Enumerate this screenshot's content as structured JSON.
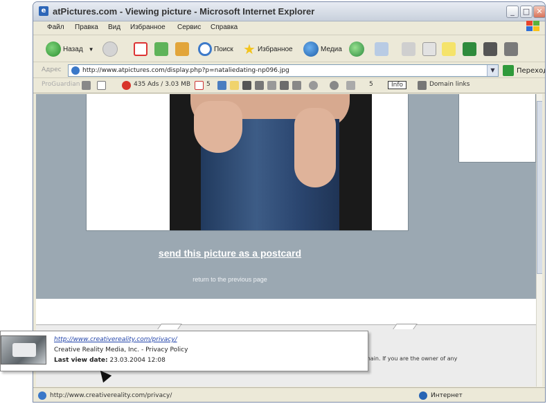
{
  "window": {
    "title": "atPictures.com - Viewing picture - Microsoft Internet Explorer",
    "minimize": "_",
    "maximize": "□",
    "close": "✕"
  },
  "menu": [
    "Файл",
    "Правка",
    "Вид",
    "Избранное",
    "Сервис",
    "Справка"
  ],
  "toolbar": {
    "back_label": "Назад",
    "search_label": "Поиск",
    "favorites_label": "Избранное",
    "media_label": "Медиа"
  },
  "address": {
    "label": "Адрес",
    "url": "http://www.atpictures.com/display.php?p=nataliedating-np096.jpg",
    "go_label": "Переход"
  },
  "links_bar": {
    "label": "ProGuardian",
    "counter": "435 Ads / 3.03 MB",
    "count5": "5",
    "count5b": "5",
    "info_label": "Info",
    "domain_label": "Domain links"
  },
  "content": {
    "postcard_link": "send this picture as a postcard",
    "return_link": "return to the previous page",
    "footer_text": "main. If you are the owner of any"
  },
  "tooltip": {
    "url": "http://www.creativereality.com/privacy/",
    "line2": "Creative Reality Media, Inc. - Privacy Policy",
    "last_view_label": "Last view date:",
    "last_view_value": "23.03.2004 12:08"
  },
  "status": {
    "url": "http://www.creativereality.com/privacy/",
    "zone": "Интернет"
  },
  "colors": {
    "content_gray": "#9ba8b2",
    "chrome": "#ece9d8",
    "link_blue": "#2244aa"
  },
  "icons": [
    "back-icon",
    "forward-icon",
    "stop-icon",
    "refresh-icon",
    "home-icon",
    "search-icon",
    "favorites-icon",
    "media-icon",
    "history-icon",
    "mail-icon",
    "print-icon",
    "edit-icon",
    "messenger-icon",
    "windows-logo-icon",
    "globe-icon",
    "mouse-cursor-icon"
  ]
}
